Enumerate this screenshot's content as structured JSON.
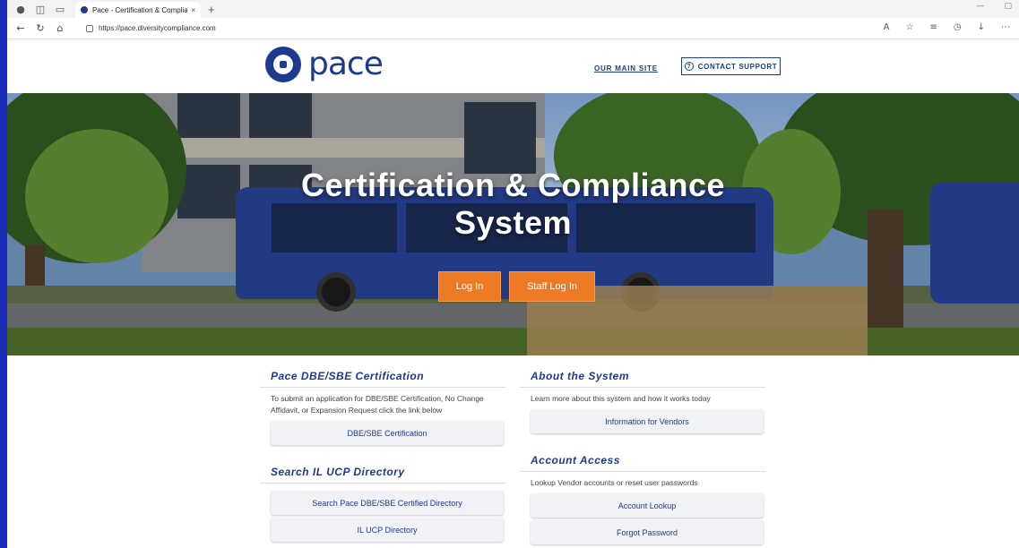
{
  "browser": {
    "tab": {
      "title": "Pace - Certification & Compliance",
      "close": "×"
    },
    "new_tab": "+",
    "window_controls": [
      "—",
      "▢"
    ],
    "url": "https://pace.diversitycompliance.com",
    "toolbar_icons": [
      "read-aloud-icon",
      "favorite-icon",
      "favorites-bar-icon",
      "history-icon",
      "download-icon",
      "more-icon"
    ]
  },
  "header": {
    "logo_text": "pace",
    "main_site_link": "OUR MAIN SITE",
    "support_button": "CONTACT SUPPORT",
    "support_icon_glyph": "?"
  },
  "hero": {
    "title_line1": "Certification & Compliance",
    "title_line2": "System",
    "login_button": "Log In",
    "staff_login_button": "Staff Log In",
    "accent_color": "#ee7a25"
  },
  "sections": {
    "dbe": {
      "title": "Pace DBE/SBE Certification",
      "description": "To submit an application for DBE/SBE Certification, No Change Affidavit, or Expansion Request click the link below",
      "button": "DBE/SBE Certification"
    },
    "search": {
      "title": "Search IL UCP Directory",
      "buttons": [
        "Search Pace DBE/SBE Certified Directory",
        "IL UCP Directory"
      ]
    },
    "about": {
      "title": "About the System",
      "description": "Learn more about this system and how it works today",
      "button": "Information for Vendors"
    },
    "account": {
      "title": "Account Access",
      "description": "Lookup Vendor accounts or reset user passwords",
      "buttons": [
        "Account Lookup",
        "Forgot Password"
      ]
    }
  },
  "colors": {
    "brand_blue": "#1d3a8f",
    "desktop_bg": "#1a2bb8"
  }
}
